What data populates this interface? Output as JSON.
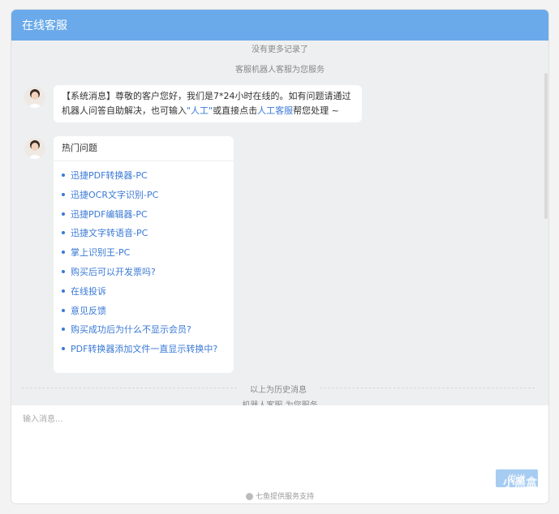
{
  "header": {
    "title": "在线客服"
  },
  "chat": {
    "no_more_records": "没有更多记录了",
    "robot_serving_top": "客服机器人客服为您服务",
    "system_message": {
      "prefix": "【系统消息】尊敬的客户您好，我们是7*24小时在线的。如有问题请通过机器人问答自助解决，也可输入",
      "link1": "\"人工\"",
      "middle": "或直接点击",
      "link2": "人工客服",
      "suffix": "帮您处理 ~"
    },
    "hot_questions": {
      "title": "热门问题",
      "items": [
        "迅捷PDF转换器-PC",
        "迅捷OCR文字识别-PC",
        "迅捷PDF编辑器-PC",
        "迅捷文字转语音-PC",
        "掌上识别王-PC",
        "购买后可以开发票吗?",
        "在线投诉",
        "意见反馈",
        "购买成功后为什么不显示会员?",
        "PDF转换器添加文件一直显示转换中?"
      ]
    },
    "history_divider": "以上为历史消息",
    "robot_serving_bottom": "机器人客服 为您服务"
  },
  "input": {
    "placeholder": "输入消息..."
  },
  "send_label": "发送",
  "footer": {
    "text": "七鱼提供服务支持"
  },
  "watermark": "小黑盒"
}
